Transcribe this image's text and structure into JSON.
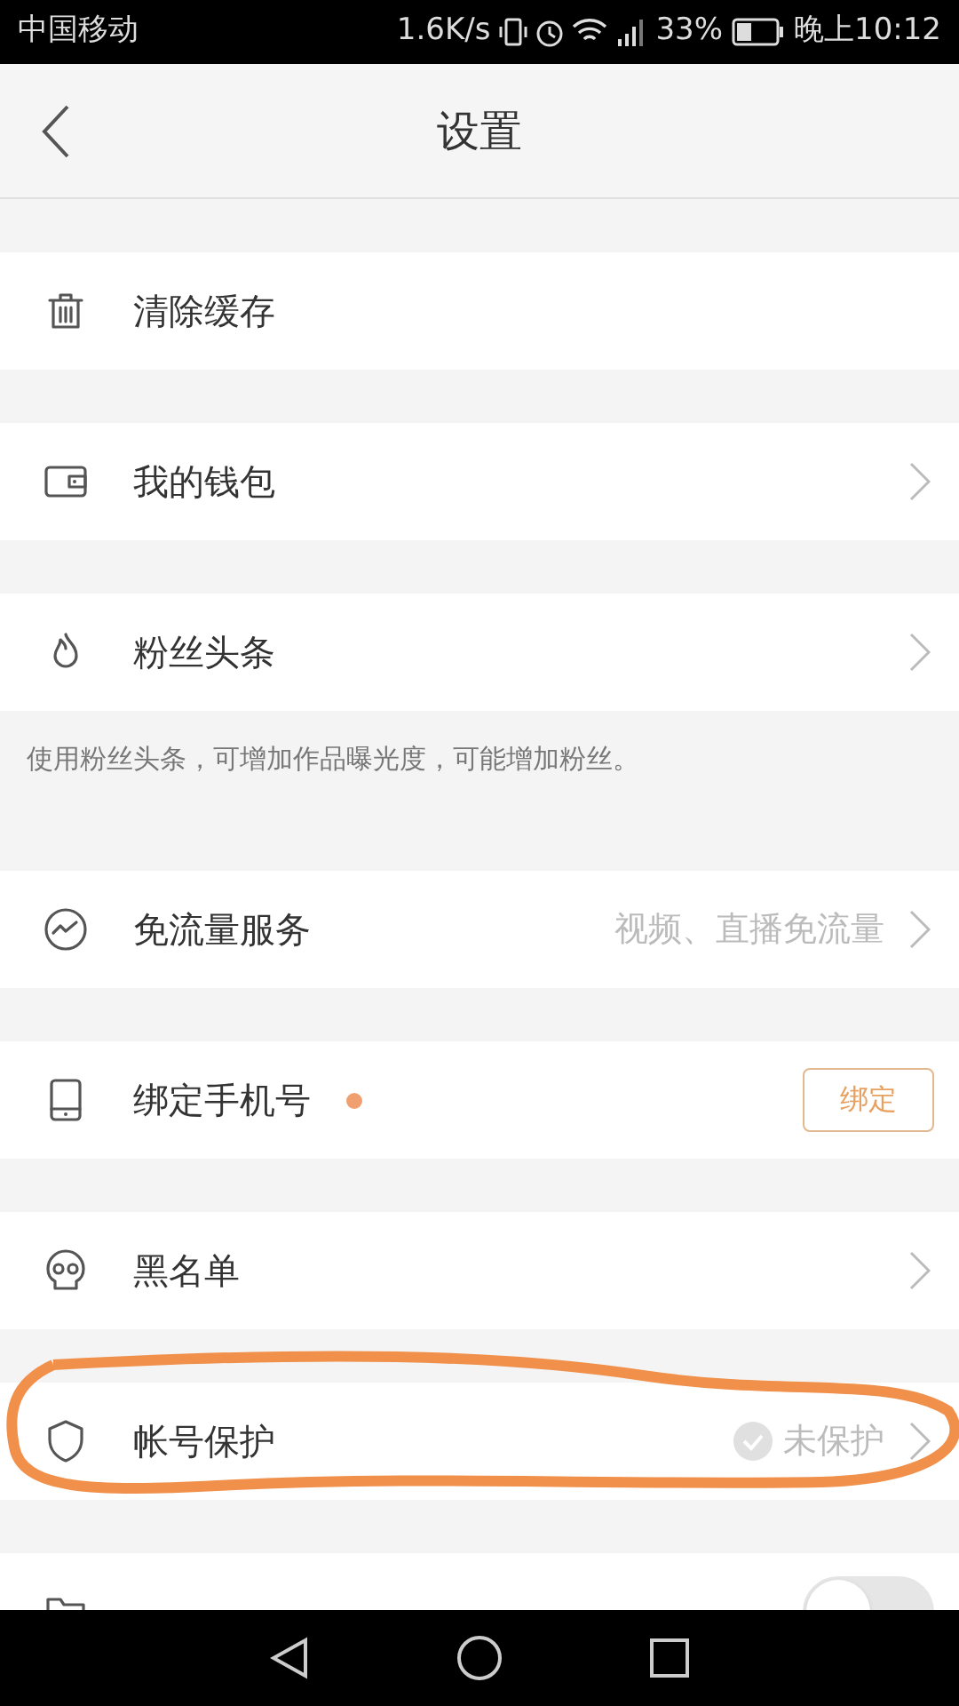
{
  "status_bar": {
    "carrier": "中国移动",
    "speed": "1.6K/s",
    "battery": "33%",
    "time": "晚上10:12"
  },
  "header": {
    "title": "设置"
  },
  "rows": [
    {
      "label": "清除缓存",
      "chevron": false
    },
    {
      "label": "我的钱包",
      "chevron": true
    },
    {
      "label": "粉丝头条",
      "chevron": true,
      "note": "使用粉丝头条，可增加作品曝光度，可能增加粉丝。"
    },
    {
      "label": "免流量服务",
      "chevron": true,
      "value": "视频、直播免流量"
    },
    {
      "label": "绑定手机号",
      "chevron": false,
      "dot": true,
      "button": "绑定"
    },
    {
      "label": "黑名单",
      "chevron": true
    },
    {
      "label": "帐号保护",
      "chevron": true,
      "value": "未保护",
      "check": true,
      "circled": true
    },
    {
      "chevron": false,
      "toggle": {
        "on": false
      }
    }
  ]
}
